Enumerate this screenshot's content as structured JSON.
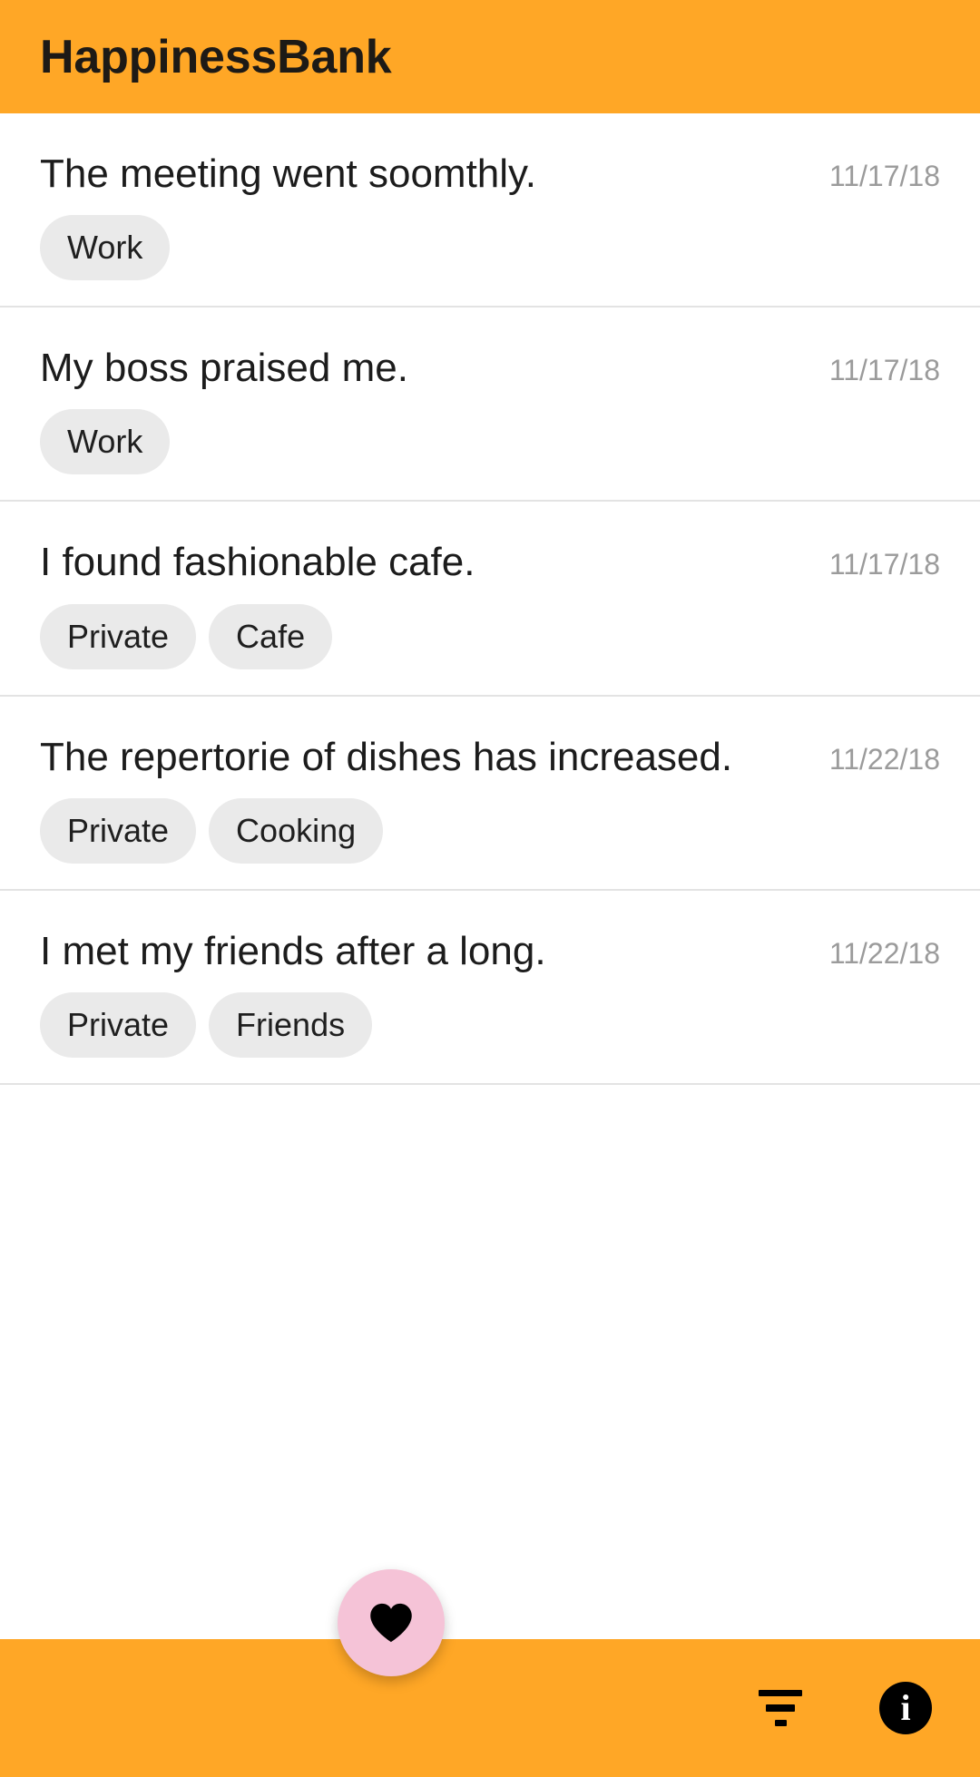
{
  "app": {
    "title": "HappinessBank",
    "header_color": "#ffa726",
    "background_color": "#ffffff"
  },
  "list": {
    "entries": [
      {
        "title": "The meeting went soomthly.",
        "date": "11/17/18",
        "tags": [
          "Work"
        ]
      },
      {
        "title": "My boss praised me.",
        "date": "11/17/18",
        "tags": [
          "Work"
        ]
      },
      {
        "title": "I found fashionable cafe.",
        "date": "11/17/18",
        "tags": [
          "Private",
          "Cafe"
        ]
      },
      {
        "title": "The repertorie of dishes has increased.",
        "date": "11/22/18",
        "tags": [
          "Private",
          "Cooking"
        ]
      },
      {
        "title": "I met my friends after a long.",
        "date": "11/22/18",
        "tags": [
          "Private",
          "Friends"
        ]
      }
    ]
  },
  "fab": {
    "icon": "heart-icon",
    "color": "#f5c3d7",
    "icon_color": "#000000"
  },
  "bottombar": {
    "color": "#ffa726",
    "actions": [
      {
        "icon": "filter-icon"
      },
      {
        "icon": "info-icon",
        "label": "i"
      }
    ]
  }
}
